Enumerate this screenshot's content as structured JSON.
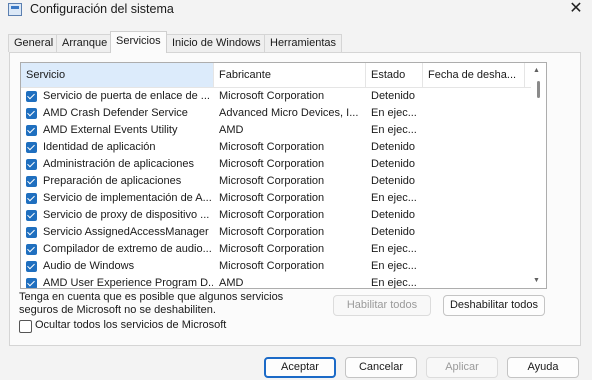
{
  "window": {
    "title": "Configuración del sistema",
    "close_glyph": "✕"
  },
  "tabs": [
    {
      "label": "General"
    },
    {
      "label": "Arranque"
    },
    {
      "label": "Servicios"
    },
    {
      "label": "Inicio de Windows"
    },
    {
      "label": "Herramientas"
    }
  ],
  "active_tab": "Servicios",
  "table": {
    "columns": [
      "Servicio",
      "Fabricante",
      "Estado",
      "Fecha de desha..."
    ],
    "rows": [
      {
        "servicio": "Servicio de puerta de enlace de ...",
        "fabricante": "Microsoft Corporation",
        "estado": "Detenido",
        "fecha": "",
        "checked": true
      },
      {
        "servicio": "AMD Crash Defender Service",
        "fabricante": "Advanced Micro Devices, I...",
        "estado": "En ejec...",
        "fecha": "",
        "checked": true
      },
      {
        "servicio": "AMD External Events Utility",
        "fabricante": "AMD",
        "estado": "En ejec...",
        "fecha": "",
        "checked": true
      },
      {
        "servicio": "Identidad de aplicación",
        "fabricante": "Microsoft Corporation",
        "estado": "Detenido",
        "fecha": "",
        "checked": true
      },
      {
        "servicio": "Administración de aplicaciones",
        "fabricante": "Microsoft Corporation",
        "estado": "Detenido",
        "fecha": "",
        "checked": true
      },
      {
        "servicio": "Preparación de aplicaciones",
        "fabricante": "Microsoft Corporation",
        "estado": "Detenido",
        "fecha": "",
        "checked": true
      },
      {
        "servicio": "Servicio de implementación de A...",
        "fabricante": "Microsoft Corporation",
        "estado": "En ejec...",
        "fecha": "",
        "checked": true
      },
      {
        "servicio": "Servicio de proxy de dispositivo ...",
        "fabricante": "Microsoft Corporation",
        "estado": "Detenido",
        "fecha": "",
        "checked": true
      },
      {
        "servicio": "Servicio AssignedAccessManager",
        "fabricante": "Microsoft Corporation",
        "estado": "Detenido",
        "fecha": "",
        "checked": true
      },
      {
        "servicio": "Compilador de extremo de audio...",
        "fabricante": "Microsoft Corporation",
        "estado": "En ejec...",
        "fecha": "",
        "checked": true
      },
      {
        "servicio": "Audio de Windows",
        "fabricante": "Microsoft Corporation",
        "estado": "En ejec...",
        "fecha": "",
        "checked": true
      },
      {
        "servicio": "AMD User Experience Program D...",
        "fabricante": "AMD",
        "estado": "En ejec...",
        "fecha": "",
        "checked": true
      }
    ]
  },
  "note": "Tenga en cuenta que es posible que algunos servicios seguros de Microsoft no se deshabiliten.",
  "buttons": {
    "enable_all": "Habilitar todos",
    "disable_all": "Deshabilitar todos",
    "accept": "Aceptar",
    "cancel": "Cancelar",
    "apply": "Aplicar",
    "help": "Ayuda"
  },
  "hide_ms_label": "Ocultar todos los servicios de Microsoft",
  "hide_ms_checked": false,
  "scroll_glyphs": {
    "up": "▲",
    "down": "▼"
  },
  "icons": [
    "app-icon",
    "close-icon",
    "checkbox-checked-icon",
    "scroll-up-icon",
    "scroll-down-icon"
  ],
  "colors": {
    "accent": "#1f6fbf",
    "header_selected": "#dcebfb",
    "primary_border": "#1b6ac7"
  }
}
